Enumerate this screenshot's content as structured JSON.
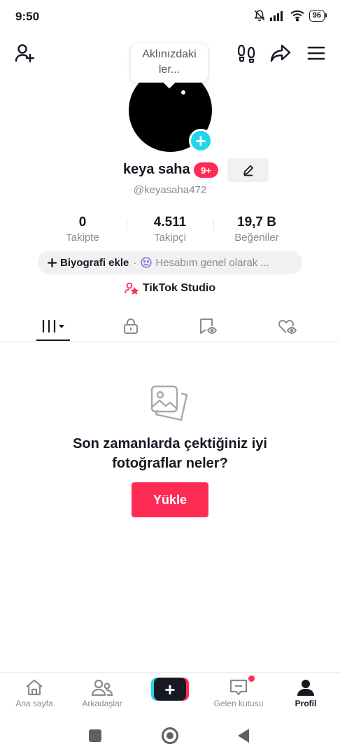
{
  "status_bar": {
    "time": "9:50",
    "battery": "96",
    "icons": [
      "bell-off-icon",
      "signal-icon",
      "wifi-icon",
      "battery-icon"
    ]
  },
  "header": {
    "icons": [
      "add-user-icon",
      "footprints-icon",
      "share-icon",
      "menu-icon"
    ]
  },
  "note_bubble": {
    "text_line1": "Aklınızdaki",
    "text_line2": "ler..."
  },
  "profile": {
    "username": "keya saha",
    "notifications_badge": "9+",
    "handle": "@keyasaha472"
  },
  "stats": [
    {
      "value": "0",
      "label": "Takipte"
    },
    {
      "value": "4.511",
      "label": "Takipçi"
    },
    {
      "value": "19,7 B",
      "label": "Beğeniler"
    }
  ],
  "bio": {
    "add_label": "Biyografi ekle",
    "separator": "·",
    "status_text": "Hesabım genel olarak ..."
  },
  "studio": {
    "label": "TikTok Studio"
  },
  "tabs": [
    "videos-grid-icon",
    "lock-icon",
    "tagged-icon",
    "liked-icon"
  ],
  "empty_state": {
    "line1": "Son zamanlarda çektiğiniz iyi",
    "line2": "fotoğraflar neler?",
    "button": "Yükle"
  },
  "bottom_nav": {
    "home": "Ana sayfa",
    "friends": "Arkadaşlar",
    "create": "+",
    "inbox": "Gelen kutusu",
    "profile": "Profil"
  },
  "colors": {
    "accent": "#fe2c55",
    "cyan": "#20d5ec",
    "text": "#161823",
    "muted": "#8a8b91",
    "chip_bg": "#f1f1f2"
  }
}
